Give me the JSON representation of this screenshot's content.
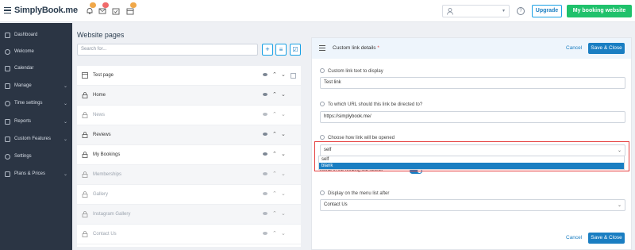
{
  "header": {
    "logo_text": "SimplyBook.me",
    "notification_badges": [
      "",
      "",
      "",
      ""
    ],
    "upgrade_label": "Upgrade",
    "my_site_label": "My booking website",
    "help_glyph": "?"
  },
  "sidebar": {
    "items": [
      {
        "label": "Dashboard",
        "icon": "dashboard-icon",
        "chevron": false
      },
      {
        "label": "Welcome",
        "icon": "compass-icon",
        "chevron": false
      },
      {
        "label": "Calendar",
        "icon": "calendar-icon",
        "chevron": false
      },
      {
        "label": "Manage",
        "icon": "pencil-icon",
        "chevron": true
      },
      {
        "label": "Time settings",
        "icon": "clock-icon",
        "chevron": true
      },
      {
        "label": "Reports",
        "icon": "chart-icon",
        "chevron": true
      },
      {
        "label": "Custom Features",
        "icon": "puzzle-icon",
        "chevron": true
      },
      {
        "label": "Settings",
        "icon": "gear-icon",
        "chevron": false
      },
      {
        "label": "Plans & Prices",
        "icon": "tag-icon",
        "chevron": true
      }
    ]
  },
  "pages": {
    "title": "Website pages",
    "search_placeholder": "Search for...",
    "list": [
      {
        "label": "Test page",
        "icon": "page-icon",
        "muted": false
      },
      {
        "label": "Home",
        "icon": "lock-icon",
        "muted": false
      },
      {
        "label": "News",
        "icon": "lock-icon",
        "muted": true
      },
      {
        "label": "Reviews",
        "icon": "lock-icon",
        "muted": false
      },
      {
        "label": "My Bookings",
        "icon": "lock-icon",
        "muted": false
      },
      {
        "label": "Memberships",
        "icon": "lock-icon",
        "muted": true
      },
      {
        "label": "Gallery",
        "icon": "lock-icon",
        "muted": true
      },
      {
        "label": "Instagram Gallery",
        "icon": "lock-icon",
        "muted": true
      },
      {
        "label": "Contact Us",
        "icon": "lock-icon",
        "muted": true
      }
    ]
  },
  "detail": {
    "title": "Custom link details",
    "required_mark": "*",
    "cancel_label": "Cancel",
    "save_label": "Save & Close",
    "fields": {
      "link_text_label": "Custom link text to display",
      "link_text_value": "Test link",
      "url_label": "To which URL should this link be directed to?",
      "url_value": "https://simplybook.me/",
      "open_label": "Choose how link will be opened",
      "open_value": "self",
      "open_options": [
        "self",
        "blank"
      ],
      "menu_after_label": "Display on the menu list after",
      "menu_after_value": "Contact Us"
    },
    "toggle_label": "Visible in the booking site header"
  },
  "colors": {
    "accent": "#1a7ec2",
    "green": "#1fc16b",
    "sidebar_bg": "#2b3544",
    "highlight": "#e53e3e"
  }
}
